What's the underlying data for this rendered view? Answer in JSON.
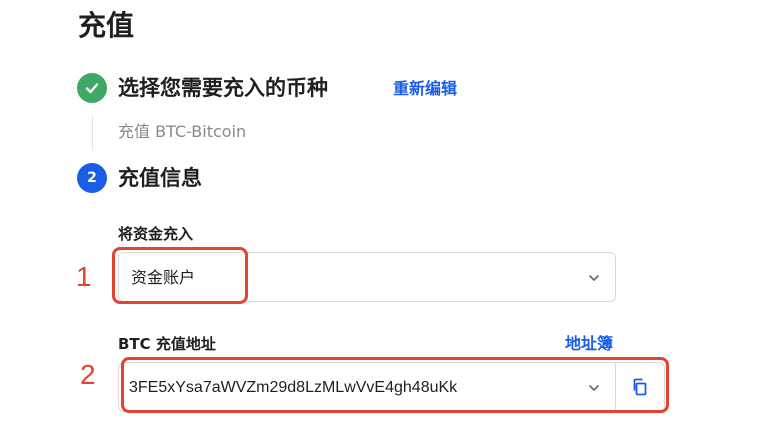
{
  "page": {
    "title": "充值"
  },
  "step1": {
    "title": "选择您需要充入的币种",
    "edit_link": "重新编辑",
    "summary": "充值 BTC-Bitcoin",
    "status": "done"
  },
  "step2": {
    "number": "2",
    "title": "充值信息",
    "deposit_to": {
      "label": "将资金充入",
      "selected": "资金账户"
    },
    "address": {
      "label": "BTC 充值地址",
      "address_book_link": "地址簿",
      "value": "3FE5xYsa7aWVZm29d8LzMLwVvE4gh48uKk"
    }
  },
  "annotations": [
    {
      "number": "1"
    },
    {
      "number": "2"
    }
  ],
  "colors": {
    "accent": "#1a5ee8",
    "success": "#3fa864",
    "annotation": "#e3432f",
    "border": "#d9d9d9"
  },
  "icons": {
    "step_done": "check-icon",
    "dropdown": "chevron-down-icon",
    "copy": "copy-icon"
  }
}
